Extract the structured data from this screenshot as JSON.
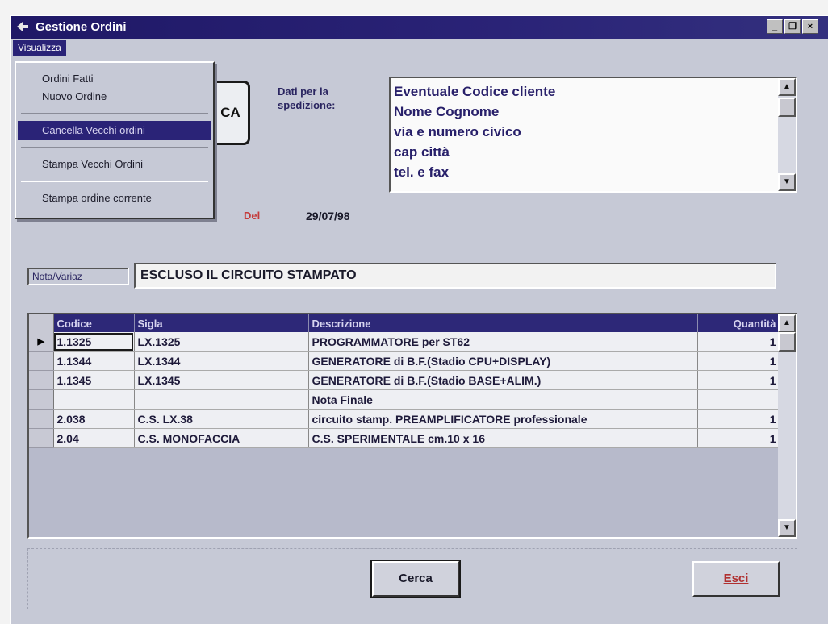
{
  "window": {
    "title": "Gestione Ordini",
    "controls": [
      "_",
      "❐",
      "×"
    ]
  },
  "menubar": {
    "visualizza": "Visualizza"
  },
  "dropdown": {
    "items": [
      {
        "label": "Ordini Fatti",
        "selected": false
      },
      {
        "label": "Nuovo Ordine",
        "selected": false
      },
      {
        "label": "Cancella Vecchi ordini",
        "selected": true
      },
      {
        "label": "Stampa Vecchi Ordini",
        "selected": false
      },
      {
        "label": "Stampa ordine corrente",
        "selected": false
      }
    ]
  },
  "fragment_button": {
    "label": "CA"
  },
  "shipping": {
    "label": "Dati per la spedizione:",
    "lines": [
      "Eventuale Codice cliente",
      "Nome Cognome",
      "via e numero civico",
      "cap città",
      "tel. e fax"
    ]
  },
  "date": {
    "label": "Del",
    "value": "29/07/98"
  },
  "note": {
    "label": "Nota/Variaz",
    "value": "ESCLUSO IL CIRCUITO STAMPATO"
  },
  "grid": {
    "columns": [
      "",
      "Codice",
      "Sigla",
      "Descrizione",
      "Quantità"
    ],
    "rows": [
      {
        "marker": "▶",
        "codice": "1.1325",
        "sigla": "LX.1325",
        "descrizione": "PROGRAMMATORE per ST62",
        "quantita": "1"
      },
      {
        "marker": "",
        "codice": "1.1344",
        "sigla": "LX.1344",
        "descrizione": "GENERATORE di B.F.(Stadio CPU+DISPLAY)",
        "quantita": "1"
      },
      {
        "marker": "",
        "codice": "1.1345",
        "sigla": "LX.1345",
        "descrizione": "GENERATORE di B.F.(Stadio BASE+ALIM.)",
        "quantita": "1"
      },
      {
        "marker": "",
        "codice": "",
        "sigla": "",
        "descrizione": "Nota Finale",
        "quantita": ""
      },
      {
        "marker": "",
        "codice": "2.038",
        "sigla": "C.S. LX.38",
        "descrizione": "circuito stamp. PREAMPLIFICATORE professionale",
        "quantita": "1"
      },
      {
        "marker": "",
        "codice": "2.04",
        "sigla": "C.S. MONOFACCIA",
        "descrizione": "C.S. SPERIMENTALE cm.10 x 16",
        "quantita": "1"
      }
    ]
  },
  "buttons": {
    "cerca": "Cerca",
    "esci": "Esci"
  }
}
